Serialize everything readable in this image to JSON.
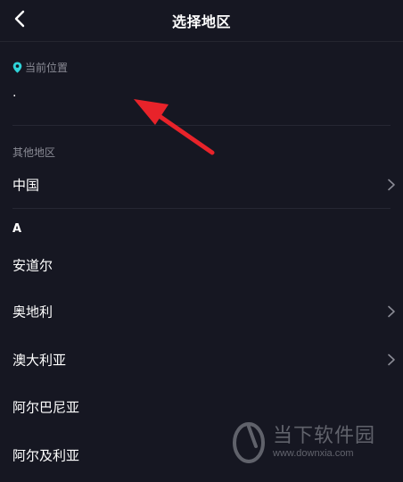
{
  "header": {
    "title": "选择地区"
  },
  "current_location": {
    "label": "当前位置",
    "value": "·"
  },
  "other_regions": {
    "label": "其他地区",
    "items": [
      {
        "label": "中国",
        "has_children": true
      }
    ]
  },
  "sections": [
    {
      "letter": "A",
      "items": [
        {
          "label": "安道尔",
          "has_children": false
        },
        {
          "label": "奥地利",
          "has_children": true
        },
        {
          "label": "澳大利亚",
          "has_children": true
        },
        {
          "label": "阿尔巴尼亚",
          "has_children": false
        },
        {
          "label": "阿尔及利亚",
          "has_children": false
        }
      ]
    }
  ],
  "watermark": {
    "name": "当下软件园",
    "url": "www.downxia.com"
  },
  "colors": {
    "background": "#161722",
    "pin_accent": "#2fd4d9",
    "annotation_arrow": "#e8232a",
    "secondary_text": "#8a8b95"
  },
  "icons": {
    "back": "chevron-left-icon",
    "pin": "location-pin-icon",
    "row_arrow": "chevron-right-icon"
  }
}
